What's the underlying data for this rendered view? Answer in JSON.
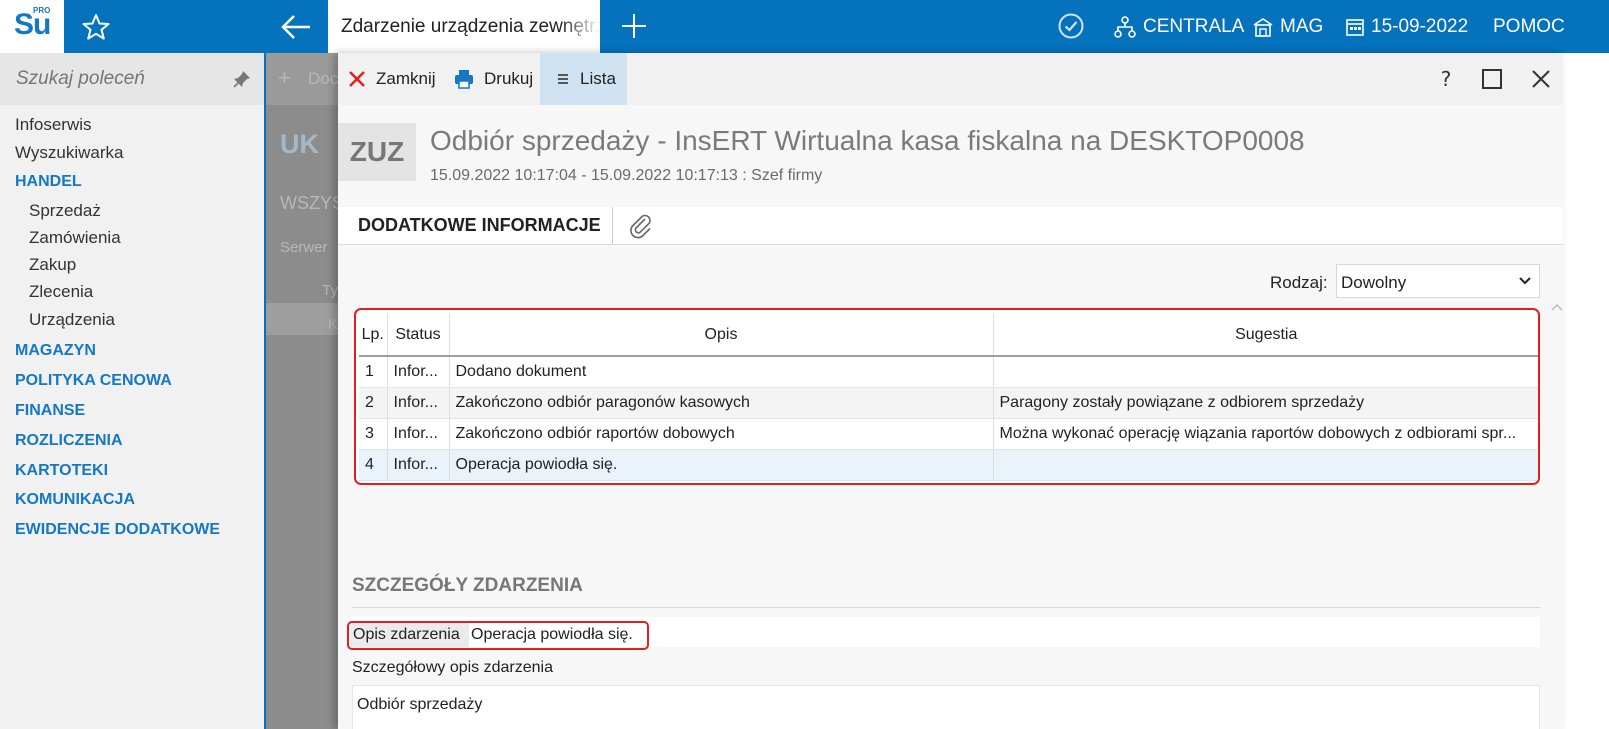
{
  "topbar": {
    "logo_text": "Su",
    "logo_sup": "PRO",
    "active_tab": "Zdarzenie urządzenia zewnętrznego",
    "company": "CENTRALA",
    "warehouse": "MAG",
    "date": "15-09-2022",
    "help": "POMOC",
    "bg_color": "#0572bd"
  },
  "sidebar": {
    "search_placeholder": "Szukaj poleceń",
    "items": [
      {
        "label": "Infoserwis"
      },
      {
        "label": "Wyszukiwarka"
      },
      {
        "label": "HANDEL"
      },
      {
        "label": "Sprzedaż"
      },
      {
        "label": "Zamówienia"
      },
      {
        "label": "Zakup"
      },
      {
        "label": "Zlecenia"
      },
      {
        "label": "Urządzenia"
      },
      {
        "label": "MAGAZYN"
      },
      {
        "label": "POLITYKA CENOWA"
      },
      {
        "label": "FINANSE"
      },
      {
        "label": "ROZLICZENIA"
      },
      {
        "label": "KARTOTEKI"
      },
      {
        "label": "KOMUNIKACJA"
      },
      {
        "label": "EWIDENCJE DODATKOWE"
      }
    ]
  },
  "background": {
    "add_label": "Doc",
    "code": "UK",
    "tab": "WSZYS",
    "filter": "Serwer",
    "col": "Ty",
    "row": "K"
  },
  "toolbar": {
    "close": "Zamknij",
    "print": "Drukuj",
    "list": "Lista"
  },
  "header": {
    "badge": "ZUZ",
    "title": "Odbiór sprzedaży - InsERT Wirtualna kasa fiskalna na DESKTOP0008",
    "subtitle": "15.09.2022 10:17:04 - 15.09.2022 10:17:13 : Szef firmy"
  },
  "tabs": {
    "active": "DODATKOWE INFORMACJE"
  },
  "filter": {
    "label": "Rodzaj:",
    "value": "Dowolny"
  },
  "grid": {
    "columns": [
      "Lp.",
      "Status",
      "Opis",
      "Sugestia"
    ],
    "rows": [
      {
        "lp": "1",
        "status": "Infor...",
        "opis": "Dodano dokument",
        "sugestia": ""
      },
      {
        "lp": "2",
        "status": "Infor...",
        "opis": "Zakończono odbiór paragonów kasowych",
        "sugestia": "Paragony zostały powiązane z odbiorem sprzedaży"
      },
      {
        "lp": "3",
        "status": "Infor...",
        "opis": "Zakończono odbiór raportów dobowych",
        "sugestia": "Można wykonać operację wiązania raportów dobowych z odbiorami spr..."
      },
      {
        "lp": "4",
        "status": "Infor...",
        "opis": "Operacja powiodła się.",
        "sugestia": ""
      }
    ]
  },
  "details": {
    "section_title": "SZCZEGÓŁY ZDARZENIA",
    "opis_label": "Opis zdarzenia",
    "opis_value": "Operacja powiodła się.",
    "det_label": "Szczegółowy opis zdarzenia",
    "det_value": "Odbiór sprzedaży"
  }
}
